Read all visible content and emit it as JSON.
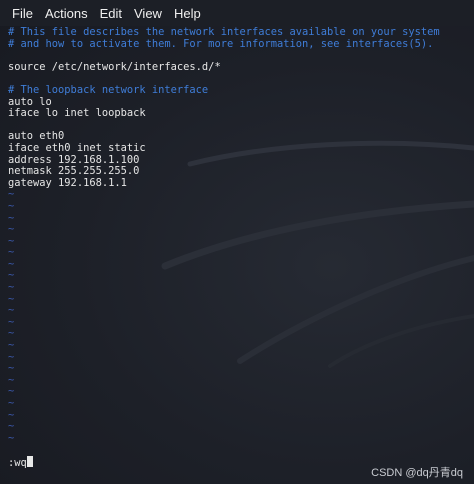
{
  "menu": [
    "File",
    "Actions",
    "Edit",
    "View",
    "Help"
  ],
  "editor": {
    "lines": [
      {
        "text": "# This file describes the network interfaces available on your system",
        "kind": "comment"
      },
      {
        "text": "# and how to activate them. For more information, see interfaces(5).",
        "kind": "comment"
      },
      {
        "text": "",
        "kind": "code"
      },
      {
        "text": "source /etc/network/interfaces.d/*",
        "kind": "code"
      },
      {
        "text": "",
        "kind": "code"
      },
      {
        "text": "# The loopback network interface",
        "kind": "comment"
      },
      {
        "text": "auto lo",
        "kind": "code"
      },
      {
        "text": "iface lo inet loopback",
        "kind": "code"
      },
      {
        "text": "",
        "kind": "code"
      },
      {
        "text": "auto eth0",
        "kind": "code"
      },
      {
        "text": "iface eth0 inet static",
        "kind": "code"
      },
      {
        "text": "address 192.168.1.100",
        "kind": "code"
      },
      {
        "text": "netmask 255.255.255.0",
        "kind": "code"
      },
      {
        "text": "gateway 192.168.1.1",
        "kind": "code"
      }
    ],
    "empty_line_marker": "~",
    "empty_line_count": 22
  },
  "command_line": ":wq",
  "watermark": "CSDN @dq丹青dq",
  "colors": {
    "comment": "#3f7dd8",
    "code": "#e6e6e6",
    "tilde": "#3a57a8",
    "background": "#1d2028"
  }
}
